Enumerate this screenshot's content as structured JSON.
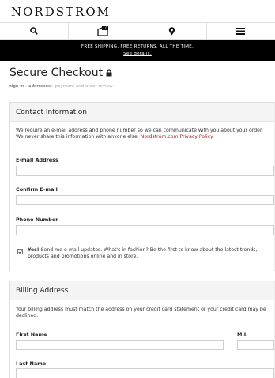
{
  "brand": {
    "logo_text": "NORDSTROM"
  },
  "nav": {
    "icons": [
      "search-icon",
      "bag-icon",
      "location-icon",
      "menu-icon"
    ],
    "bag_count": "0"
  },
  "promo": {
    "text": "FREE SHIPPING. FREE RETURNS. ALL THE TIME.",
    "link": "See details."
  },
  "page": {
    "title": "Secure Checkout",
    "breadcrumb": {
      "steps": [
        "sign-in",
        "addresses",
        "payment and order review"
      ],
      "separator": "›"
    }
  },
  "contact": {
    "heading": "Contact Information",
    "description": "We require an e-mail address and phone number so we can communicate with you about your order. We never share this information with anyone else. ",
    "privacy_link": "Nordstrom.com Privacy Policy",
    "email_label": "E-mail Address",
    "email_value": "",
    "confirm_label": "Confirm E-mail",
    "confirm_value": "",
    "phone_label": "Phone Number",
    "phone_value": "",
    "optin_checked": true,
    "optin_yes": "Yes!",
    "optin_text": " Send me e-mail updates. What's in fashion? Be the first to know about the latest trends, products and promotions online and in store."
  },
  "billing": {
    "heading": "Billing Address",
    "description": "Your billing address must match the address on your credit card statement or your credit card may be declined.",
    "first_name_label": "First Name",
    "first_name_value": "",
    "mi_label": "M.I.",
    "mi_value": "",
    "last_name_label": "Last Name",
    "last_name_value": ""
  },
  "colors": {
    "link": "#b01c1c",
    "promo_bg": "#000000",
    "header_bg": "#f4f4f4"
  }
}
